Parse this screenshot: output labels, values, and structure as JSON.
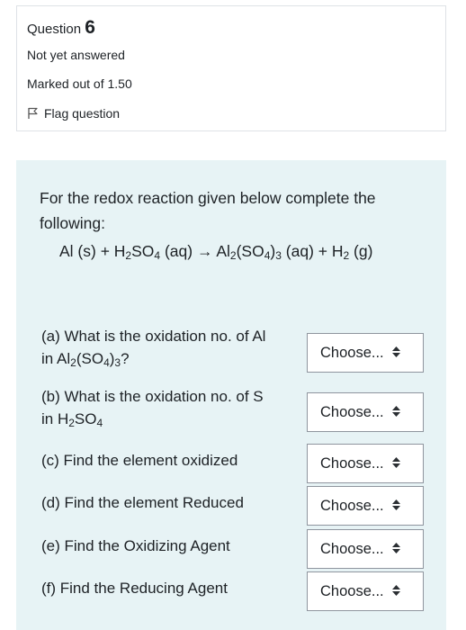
{
  "info": {
    "question_label": "Question",
    "question_number": "6",
    "state": "Not yet answered",
    "grade": "Marked out of 1.50",
    "flag_label": "Flag question"
  },
  "question": {
    "text": "For the redox reaction given below complete the following:",
    "equation": {
      "t1": "Al (s) + H",
      "s1": "2",
      "t2": "SO",
      "s2": "4",
      "t3": " (aq) → Al",
      "s3": "2",
      "t4": "(SO",
      "s4": "4",
      "t5": ")",
      "s5": "3",
      "t6": " (aq)  + H",
      "s6": "2",
      "t7": " (g)"
    }
  },
  "parts": {
    "a": {
      "line1": "(a) What is the oxidation no. of Al",
      "l2a": "in Al",
      "s1": "2",
      "l2b": "(SO",
      "s2": "4",
      "l2c": ")",
      "s3": "3",
      "l2d": "?",
      "select": "Choose..."
    },
    "b": {
      "line1": "(b) What is the oxidation no. of S",
      "l2a": "in H",
      "s1": "2",
      "l2b": "SO",
      "s2": "4",
      "select": "Choose..."
    },
    "c": {
      "label": "(c) Find the element oxidized",
      "select": "Choose..."
    },
    "d": {
      "label": "(d) Find the element Reduced",
      "select": "Choose..."
    },
    "e": {
      "label": "(e) Find the Oxidizing Agent",
      "select": "Choose..."
    },
    "f": {
      "label": "(f)  Find the Reducing Agent",
      "select": "Choose..."
    }
  }
}
